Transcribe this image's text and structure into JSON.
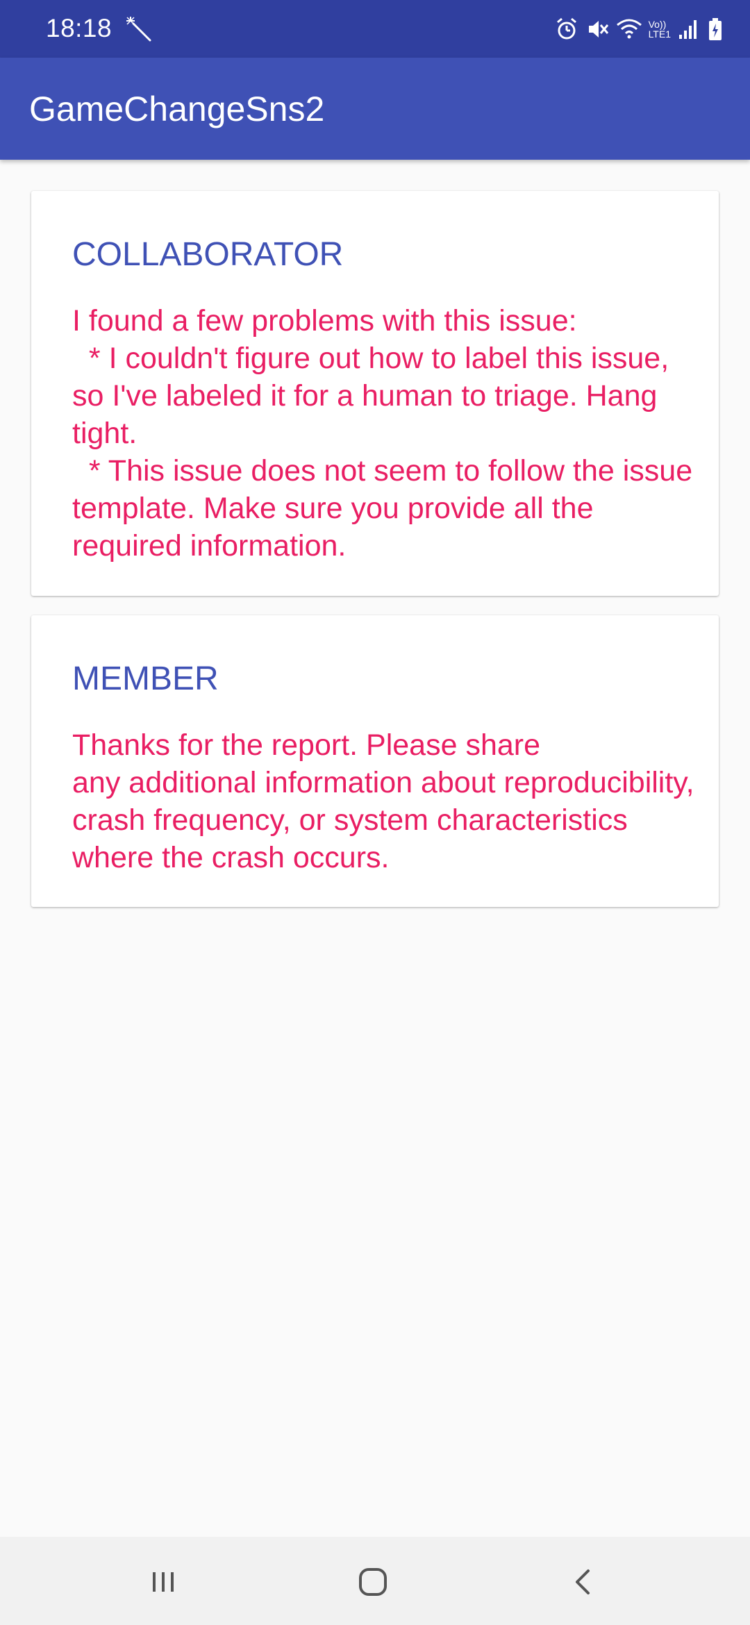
{
  "status_bar": {
    "time": "18:18",
    "network_label_top": "Vo))",
    "network_label_bottom": "LTE1",
    "icons": [
      "wand-icon",
      "alarm-icon",
      "mute-icon",
      "wifi-icon",
      "signal-icon",
      "battery-icon"
    ]
  },
  "app_bar": {
    "title": "GameChangeSns2"
  },
  "comments": [
    {
      "role": "COLLABORATOR",
      "body": "I found a few problems with this issue:\n  * I couldn't figure out how to label this issue, so I've labeled it for a human to triage. Hang tight.\n  * This issue does not seem to follow the issue template. Make sure you provide all the required information."
    },
    {
      "role": "MEMBER",
      "body": "Thanks for the report. Please share\nany additional information about reproducibility, crash frequency, or system characteristics where the crash occurs."
    }
  ],
  "colors": {
    "status_bar": "#303f9f",
    "app_bar": "#3f51b5",
    "role_text": "#3f51b5",
    "body_text": "#e91e63",
    "background": "#fafafa"
  },
  "nav_bar": {
    "icons": [
      "recents-icon",
      "home-icon",
      "back-icon"
    ]
  }
}
